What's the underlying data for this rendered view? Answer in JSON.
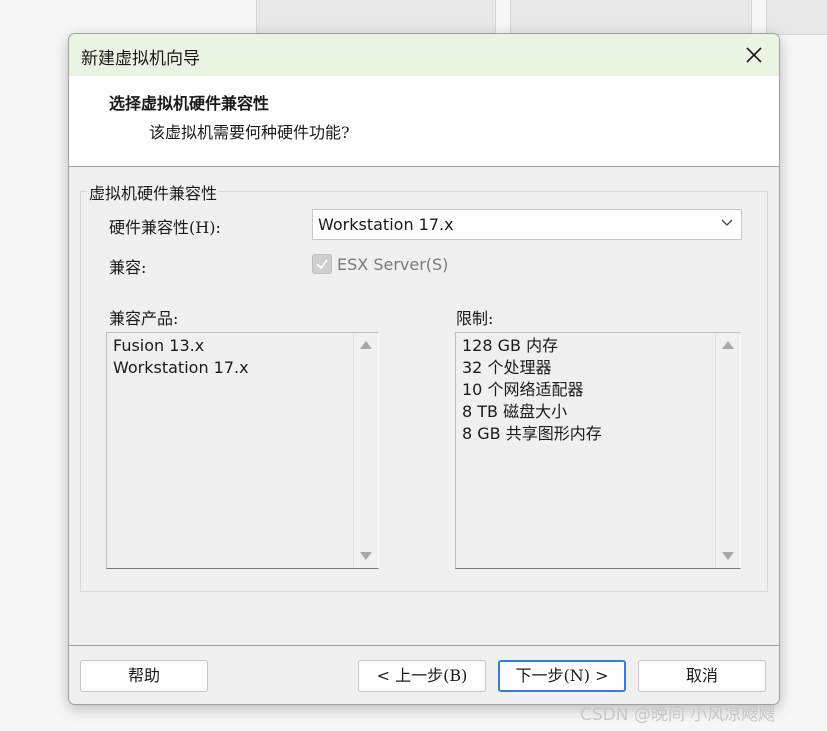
{
  "window": {
    "title": "新建虚拟机向导"
  },
  "header": {
    "title": "选择虚拟机硬件兼容性",
    "subtitle": "该虚拟机需要何种硬件功能?"
  },
  "group": {
    "legend": "虚拟机硬件兼容性",
    "compat_label": "硬件兼容性(H):",
    "compat_value": "Workstation 17.x",
    "compatible_label": "兼容:",
    "esx_checkbox_label": "ESX Server(S)",
    "esx_checked": true,
    "products_label": "兼容产品:",
    "products": [
      "Fusion 13.x",
      "Workstation 17.x"
    ],
    "limits_label": "限制:",
    "limits": [
      "128 GB 内存",
      "32 个处理器",
      "10 个网络适配器",
      "8 TB 磁盘大小",
      "8 GB 共享图形内存"
    ]
  },
  "buttons": {
    "help": "帮助",
    "back": "< 上一步(B)",
    "next": "下一步(N) >",
    "cancel": "取消"
  },
  "watermark": "CSDN @晚间 小风凉飕飕"
}
